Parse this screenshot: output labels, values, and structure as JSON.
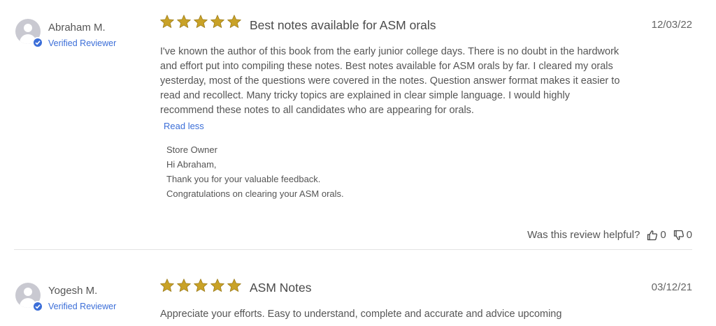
{
  "colors": {
    "star": "#c9a227",
    "star_outline": "#9a7a18",
    "link": "#3b6ed8",
    "text": "#555555",
    "divider": "#e3e3e3"
  },
  "reviews": [
    {
      "reviewer": "Abraham M.",
      "badge_icon": "verified-check-icon",
      "verified_label": "Verified Reviewer",
      "rating": 5,
      "title": "Best notes available for ASM orals",
      "date": "12/03/22",
      "body": "I've known the author of this book from the early junior college days. There is no doubt in the hardwork and effort put into compiling these notes. Best notes available for ASM orals by far. I cleared my orals yesterday, most of the questions were covered in the notes. Question answer format makes it easier to read and recollect. Many tricky topics are explained in clear simple language. I would highly recommend these notes to all candidates who are appearing for orals.",
      "toggle_label": "Read less",
      "reply": {
        "author": "Store Owner",
        "lines": [
          "Hi Abraham,",
          "Thank you for your valuable feedback.",
          "Congratulations on clearing your ASM orals."
        ]
      },
      "helpful": {
        "question": "Was this review helpful?",
        "up_icon": "thumbs-up-icon",
        "up_count": "0",
        "down_icon": "thumbs-down-icon",
        "down_count": "0"
      }
    },
    {
      "reviewer": "Yogesh M.",
      "badge_icon": "verified-check-icon",
      "verified_label": "Verified Reviewer",
      "rating": 5,
      "title": "ASM Notes",
      "date": "03/12/21",
      "body": "Appreciate your efforts. Easy to understand, complete and accurate and advice upcoming"
    }
  ]
}
